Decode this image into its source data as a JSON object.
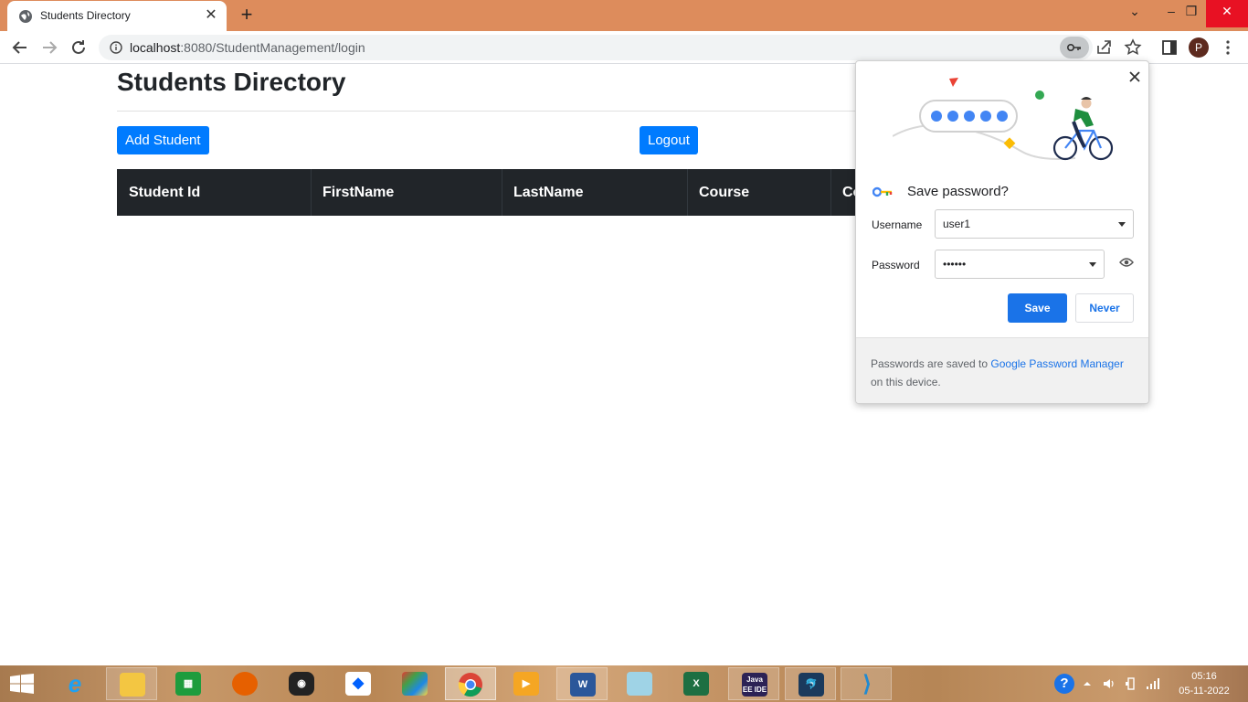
{
  "browser": {
    "tab_title": "Students Directory",
    "url_host": "localhost",
    "url_path": ":8080/StudentManagement/login",
    "profile_initial": "P"
  },
  "page": {
    "title": "Students Directory",
    "add_button": "Add Student",
    "logout_button": "Logout",
    "columns": [
      "Student Id",
      "FirstName",
      "LastName",
      "Course",
      "Co"
    ]
  },
  "popup": {
    "heading": "Save password?",
    "username_label": "Username",
    "username_value": "user1",
    "password_label": "Password",
    "password_value": "••••••",
    "save_label": "Save",
    "never_label": "Never",
    "footer_prefix": "Passwords are saved to ",
    "footer_link": "Google Password Manager",
    "footer_suffix": " on this device."
  },
  "taskbar": {
    "apps": [
      "start-button",
      "internet-explorer",
      "file-explorer",
      "store",
      "firefox",
      "media-app",
      "dropbox",
      "puzzle-app",
      "chrome",
      "media-player",
      "word",
      "notepad",
      "excel",
      "java-ee-ide",
      "mysql-workbench",
      "vscode"
    ],
    "java_label": "Java EE IDE",
    "time": "05:16",
    "date": "05-11-2022"
  },
  "colors": {
    "titlebar": "#dd8c5c",
    "primary_button": "#007bff",
    "table_header": "#212529",
    "popup_save": "#1a73e8"
  }
}
